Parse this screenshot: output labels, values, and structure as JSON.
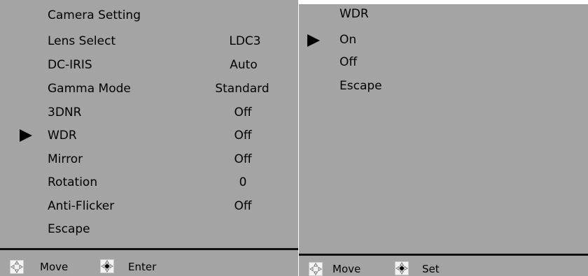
{
  "left_menu": {
    "items": [
      {
        "label": "Camera Setting",
        "value": ""
      },
      {
        "label": "Lens Select",
        "value": "LDC3"
      },
      {
        "label": "DC-IRIS",
        "value": "Auto"
      },
      {
        "label": "Gamma Mode",
        "value": "Standard"
      },
      {
        "label": "3DNR",
        "value": "Off"
      },
      {
        "label": "WDR",
        "value": "Off"
      },
      {
        "label": "Mirror",
        "value": "Off"
      },
      {
        "label": "Rotation",
        "value": "0"
      },
      {
        "label": "Anti-Flicker",
        "value": "Off"
      },
      {
        "label": "Escape",
        "value": ""
      }
    ],
    "selected_index": 5,
    "footer": {
      "nav_label": "Move",
      "enter_label": "Enter"
    }
  },
  "right_menu": {
    "title": "WDR",
    "options": [
      {
        "label": "On"
      },
      {
        "label": "Off"
      },
      {
        "label": "Escape"
      }
    ],
    "selected_index": 0,
    "footer": {
      "nav_label": "Move",
      "set_label": "Set"
    }
  },
  "icons": {
    "selection": "triangle-right-icon",
    "navigate": "dpad-arrows-icon",
    "confirm": "dpad-center-dot-icon"
  },
  "colors": {
    "panel_bg": "#a4a4a4",
    "text": "#000000",
    "divider": "#111111",
    "icon_bg": "#f3f3f3"
  }
}
